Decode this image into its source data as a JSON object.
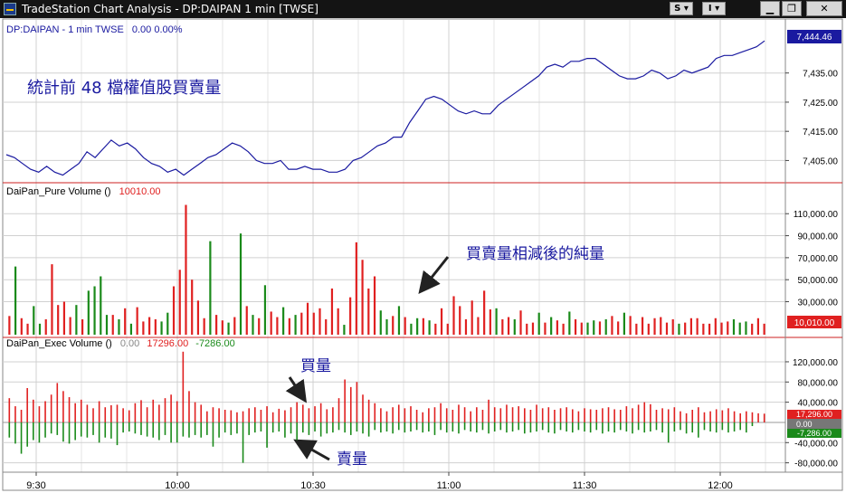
{
  "window": {
    "title": "TradeStation Chart Analysis - DP:DAIPAN 1 min [TWSE]",
    "btn_s": "S ▾",
    "btn_i": "I ▾",
    "minimize": "▁",
    "restore": "❐",
    "close": "✕"
  },
  "panel1": {
    "header_symbol": "DP:DAIPAN - 1 min  TWSE",
    "header_values": "0.00  0.00%",
    "annotation": "統計前  48  檔權值股買賣量",
    "last_value": "7,444.46",
    "y_ticks": [
      "7,435.00",
      "7,425.00",
      "7,415.00",
      "7,405.00"
    ],
    "colors": {
      "line": "#1a1aa0",
      "header": "#1a1aa0"
    }
  },
  "panel2": {
    "header_label": "DaiPan_Pure Volume ()",
    "header_value": "10010.00",
    "annotation": "買賣量相減後的純量",
    "last_value": "10,010.00",
    "y_ticks": [
      "110,000.00",
      "90,000.00",
      "70,000.00",
      "50,000.00",
      "30,000.00"
    ],
    "colors": {
      "up": "#e02020",
      "down": "#1a8a1a"
    }
  },
  "panel3": {
    "header_label": "DaiPan_Exec Volume ()",
    "header_v1": "0.00",
    "header_v2": "17296.00",
    "header_v3": "-7286.00",
    "annotation_buy": "買量",
    "annotation_sell": "賣量",
    "last_buy": "17,296.00",
    "last_zero": "0.00",
    "last_sell": "-7,286.00",
    "y_ticks": [
      "120,000.00",
      "80,000.00",
      "40,000.00",
      "-40,000.00",
      "-80,000.00"
    ]
  },
  "x_axis": {
    "ticks": [
      "9:30",
      "10:00",
      "10:30",
      "11:00",
      "11:30",
      "12:00"
    ]
  },
  "chart_data": [
    {
      "type": "line",
      "name": "DP:DAIPAN",
      "ylim": [
        7398,
        7447
      ],
      "values": [
        7407,
        7406,
        7404,
        7402,
        7401,
        7403,
        7401,
        7400,
        7402,
        7404,
        7408,
        7406,
        7409,
        7412,
        7410,
        7411,
        7409,
        7406,
        7404,
        7403,
        7401,
        7402,
        7400,
        7402,
        7404,
        7406,
        7407,
        7409,
        7411,
        7410,
        7408,
        7405,
        7404,
        7404,
        7405,
        7402,
        7402,
        7403,
        7402,
        7402,
        7401,
        7401,
        7402,
        7405,
        7406,
        7408,
        7410,
        7411,
        7413,
        7413,
        7418,
        7422,
        7426,
        7427,
        7426,
        7424,
        7422,
        7421,
        7422,
        7421,
        7421,
        7424,
        7426,
        7428,
        7430,
        7432,
        7434,
        7437,
        7438,
        7437,
        7439,
        7439,
        7440,
        7440,
        7438,
        7436,
        7434,
        7433,
        7433,
        7434,
        7436,
        7435,
        7433,
        7434,
        7436,
        7435,
        7436,
        7437,
        7440,
        7441,
        7441,
        7442,
        7443,
        7444,
        7446
      ]
    },
    {
      "type": "bar",
      "name": "DaiPan_Pure Volume",
      "ylim": [
        0,
        125000
      ],
      "values": [
        17000,
        -62000,
        15000,
        10000,
        -26000,
        -10000,
        14000,
        64000,
        27000,
        30000,
        16000,
        -27000,
        14000,
        -40000,
        -44000,
        -53000,
        -18000,
        18000,
        -14000,
        24000,
        -10000,
        25000,
        12000,
        16000,
        14000,
        -12000,
        -20000,
        44000,
        59000,
        118000,
        50000,
        31000,
        15000,
        -85000,
        18000,
        13000,
        -11000,
        16000,
        -92000,
        26000,
        -18000,
        15000,
        -45000,
        21000,
        16000,
        -25000,
        15000,
        -18000,
        20000,
        29000,
        20000,
        24000,
        14000,
        42000,
        24000,
        -9000,
        34000,
        84000,
        68000,
        42000,
        53000,
        -22000,
        -14000,
        17000,
        -26000,
        16000,
        -10000,
        -15000,
        15000,
        -13000,
        10000,
        24000,
        10000,
        35000,
        26000,
        14000,
        31000,
        16000,
        40000,
        23000,
        -24000,
        14000,
        16000,
        -14000,
        22000,
        10000,
        11000,
        -20000,
        11000,
        -16000,
        13000,
        10000,
        -21000,
        14000,
        11000,
        -11000,
        -13000,
        12000,
        -14000,
        17000,
        12000,
        -20000,
        17000,
        10000,
        16000,
        10000,
        15000,
        16000,
        11000,
        14000,
        -10000,
        11000,
        15000,
        15000,
        10000,
        10000,
        15000,
        11000,
        12000,
        -14000,
        -11000,
        -12000,
        10000,
        15000,
        10000
      ]
    },
    {
      "type": "bar",
      "name": "DaiPan_Exec Volume",
      "ylim": [
        -95000,
        145000
      ],
      "buy": [
        48000,
        32000,
        25000,
        68000,
        45000,
        32000,
        42000,
        55000,
        78000,
        62000,
        50000,
        38000,
        45000,
        35000,
        28000,
        42000,
        30000,
        34000,
        35000,
        28000,
        24000,
        38000,
        44000,
        30000,
        45000,
        35000,
        48000,
        55000,
        42000,
        140000,
        62000,
        40000,
        35000,
        22000,
        30000,
        28000,
        25000,
        24000,
        20000,
        22000,
        28000,
        30000,
        25000,
        32000,
        20000,
        27000,
        24000,
        30000,
        40000,
        35000,
        28000,
        32000,
        38000,
        26000,
        30000,
        48000,
        85000,
        70000,
        80000,
        55000,
        45000,
        38000,
        28000,
        22000,
        30000,
        35000,
        28000,
        32000,
        25000,
        20000,
        28000,
        30000,
        38000,
        28000,
        25000,
        35000,
        30000,
        22000,
        30000,
        25000,
        45000,
        30000,
        28000,
        35000,
        30000,
        32000,
        28000,
        25000,
        35000,
        28000,
        30000,
        25000,
        28000,
        30000,
        26000,
        22000,
        28000,
        26000,
        25000,
        28000,
        30000,
        26000,
        25000,
        32000,
        28000,
        35000,
        40000,
        36000,
        25000,
        28000,
        26000,
        30000,
        22000,
        18000,
        25000,
        30000,
        20000,
        22000,
        26000,
        24000,
        28000,
        22000,
        18000,
        22000,
        20000,
        18000,
        17296
      ],
      "sell": [
        -30000,
        -42000,
        -62000,
        -48000,
        -35000,
        -40000,
        -30000,
        -22000,
        -25000,
        -38000,
        -42000,
        -35000,
        -28000,
        -30000,
        -25000,
        -40000,
        -30000,
        -32000,
        -45000,
        -20000,
        -18000,
        -22000,
        -25000,
        -28000,
        -30000,
        -35000,
        -25000,
        -40000,
        -40000,
        -28000,
        -30000,
        -25000,
        -30000,
        -25000,
        -48000,
        -30000,
        -20000,
        -25000,
        -22000,
        -80000,
        -25000,
        -20000,
        -18000,
        -50000,
        -20000,
        -18000,
        -30000,
        -22000,
        -35000,
        -20000,
        -25000,
        -18000,
        -28000,
        -22000,
        -20000,
        -15000,
        -20000,
        -25000,
        -18000,
        -22000,
        -28000,
        -15000,
        -20000,
        -18000,
        -22000,
        -15000,
        -20000,
        -18000,
        -15000,
        -20000,
        -18000,
        -25000,
        -15000,
        -20000,
        -18000,
        -22000,
        -15000,
        -18000,
        -20000,
        -15000,
        -22000,
        -18000,
        -15000,
        -20000,
        -18000,
        -15000,
        -22000,
        -20000,
        -18000,
        -15000,
        -20000,
        -22000,
        -15000,
        -18000,
        -20000,
        -15000,
        -18000,
        -20000,
        -15000,
        -22000,
        -18000,
        -20000,
        -15000,
        -18000,
        -22000,
        -15000,
        -20000,
        -18000,
        -15000,
        -20000,
        -40000,
        -18000,
        -15000,
        -22000,
        -20000,
        -30000,
        -15000,
        -18000,
        -20000,
        -15000,
        -20000,
        -18000,
        -15000,
        -20000,
        -7286
      ]
    }
  ]
}
